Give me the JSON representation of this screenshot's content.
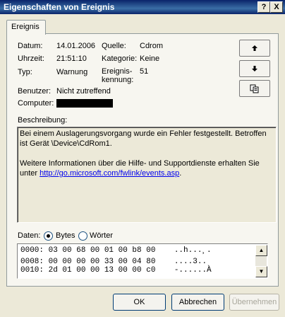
{
  "window": {
    "title": "Eigenschaften von Ereignis",
    "help_label": "?",
    "close_label": "X"
  },
  "tab": {
    "label": "Ereignis"
  },
  "fields": {
    "datum_label": "Datum:",
    "datum_value": "14.01.2006",
    "uhrzeit_label": "Uhrzeit:",
    "uhrzeit_value": "21:51:10",
    "typ_label": "Typ:",
    "typ_value": "Warnung",
    "quelle_label": "Quelle:",
    "quelle_value": "Cdrom",
    "kategorie_label": "Kategorie:",
    "kategorie_value": "Keine",
    "kennung_label_1": "Ereignis-",
    "kennung_label_2": "kennung:",
    "kennung_value": "51",
    "benutzer_label": "Benutzer:",
    "benutzer_value": "Nicht zutreffend",
    "computer_label": "Computer:"
  },
  "nav": {
    "up_icon": "arrow-up-icon",
    "down_icon": "arrow-down-icon",
    "copy_icon": "copy-icon"
  },
  "description": {
    "label": "Beschreibung:",
    "line1": "Bei einem Auslagerungsvorgang wurde ein Fehler festgestellt. Betroffen ist Gerät \\Device\\CdRom1.",
    "line2_prefix": "Weitere Informationen über die Hilfe- und Supportdienste erhalten Sie unter ",
    "link": "http://go.microsoft.com/fwlink/events.asp",
    "link_suffix": "."
  },
  "data": {
    "label": "Daten:",
    "option_bytes": "Bytes",
    "option_words": "Wörter",
    "selected": "Bytes",
    "rows": [
      "0000: 03 00 68 00 01 00 b8 00    ..h...¸.",
      "0008: 00 00 00 00 33 00 04 80    ....3..",
      "0010: 2d 01 00 00 13 00 00 c0    -......À"
    ]
  },
  "buttons": {
    "ok": "OK",
    "cancel": "Abbrechen",
    "apply": "Übernehmen"
  }
}
